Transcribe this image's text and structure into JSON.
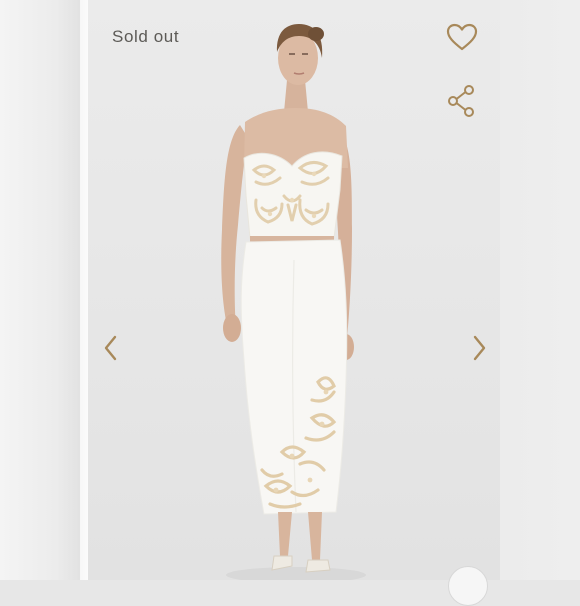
{
  "listing": {
    "status_label": "Sold out"
  },
  "icons": {
    "like": "heart-outline-icon",
    "share": "share-icon",
    "prev": "chevron-left-icon",
    "next": "chevron-right-icon"
  },
  "colors": {
    "accent": "#a8895a",
    "status_text": "#5c5a56",
    "background": "#e7e7e7",
    "garment": "#f7f6f2",
    "embroidery": "#e4d3b3"
  }
}
